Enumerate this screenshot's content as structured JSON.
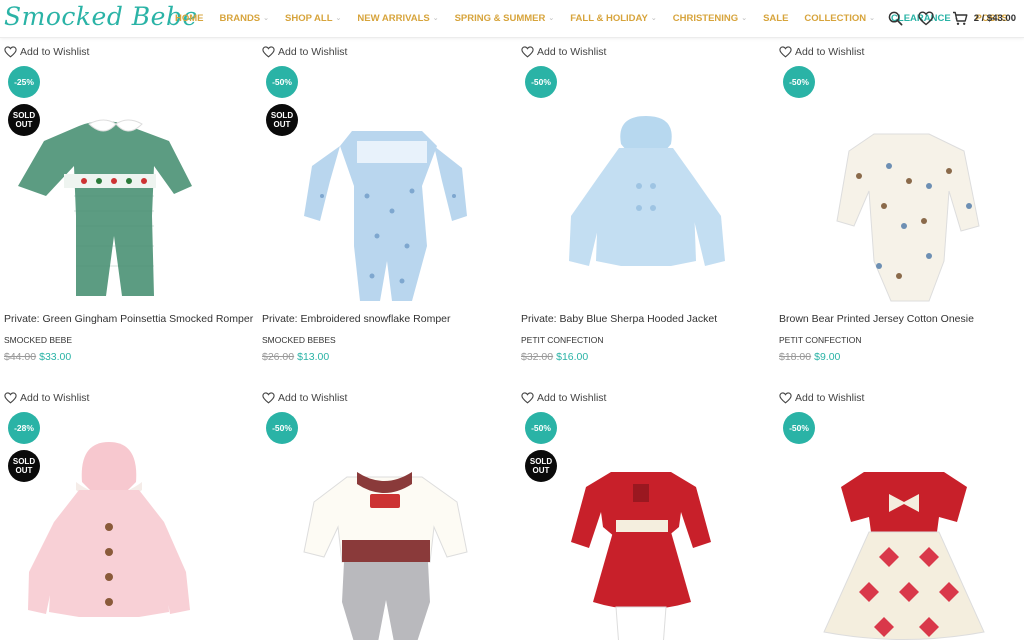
{
  "site": {
    "logo": "Smocked Bebe"
  },
  "nav": [
    {
      "label": "HOME",
      "caret": false,
      "teal": false
    },
    {
      "label": "BRANDS",
      "caret": true,
      "teal": false
    },
    {
      "label": "SHOP ALL",
      "caret": true,
      "teal": false
    },
    {
      "label": "NEW ARRIVALS",
      "caret": true,
      "teal": false
    },
    {
      "label": "SPRING & SUMMER",
      "caret": true,
      "teal": false
    },
    {
      "label": "FALL & HOLIDAY",
      "caret": true,
      "teal": false
    },
    {
      "label": "CHRISTENING",
      "caret": true,
      "teal": false
    },
    {
      "label": "SALE",
      "caret": false,
      "teal": false
    },
    {
      "label": "COLLECTION",
      "caret": true,
      "teal": false
    },
    {
      "label": "CLEARANCE",
      "caret": true,
      "teal": true
    },
    {
      "label": "POSTS",
      "caret": true,
      "teal": false
    }
  ],
  "header": {
    "cart_text": "2 / $43.00",
    "icons": [
      "search-icon",
      "heart-icon",
      "cart-icon"
    ]
  },
  "wishlist_label": "Add to Wishlist",
  "colors": {
    "accent": "#2ab3a6",
    "nav": "#d7a43c",
    "sold": "#0a0a0a"
  },
  "products": [
    {
      "title": "Private: Green Gingham Poinsettia Smocked Romper",
      "brand": "SMOCKED BEBE",
      "old_price": "$44.00",
      "price": "$33.00",
      "discount": "-25%",
      "sold_out": "SOLD\nOUT",
      "img": "green-romper"
    },
    {
      "title": "Private: Embroidered snowflake Romper",
      "brand": "SMOCKED BEBES",
      "old_price": "$26.00",
      "price": "$13.00",
      "discount": "-50%",
      "sold_out": "SOLD\nOUT",
      "img": "blue-romper"
    },
    {
      "title": "Private: Baby Blue Sherpa Hooded Jacket",
      "brand": "PETIT CONFECTION",
      "old_price": "$32.00",
      "price": "$16.00",
      "discount": "-50%",
      "sold_out": null,
      "img": "blue-jacket"
    },
    {
      "title": "Brown Bear Printed Jersey Cotton Onesie",
      "brand": "PETIT CONFECTION",
      "old_price": "$18.00",
      "price": "$9.00",
      "discount": "-50%",
      "sold_out": null,
      "img": "onesie"
    },
    {
      "title": "",
      "brand": "",
      "old_price": "",
      "price": "",
      "discount": "-28%",
      "sold_out": "SOLD\nOUT",
      "img": "pink-jacket"
    },
    {
      "title": "",
      "brand": "",
      "old_price": "",
      "price": "",
      "discount": "-50%",
      "sold_out": null,
      "img": "white-footie"
    },
    {
      "title": "",
      "brand": "",
      "old_price": "",
      "price": "",
      "discount": "-50%",
      "sold_out": "SOLD\nOUT",
      "img": "red-dress"
    },
    {
      "title": "",
      "brand": "",
      "old_price": "",
      "price": "",
      "discount": "-50%",
      "sold_out": null,
      "img": "red-white-dress"
    }
  ]
}
